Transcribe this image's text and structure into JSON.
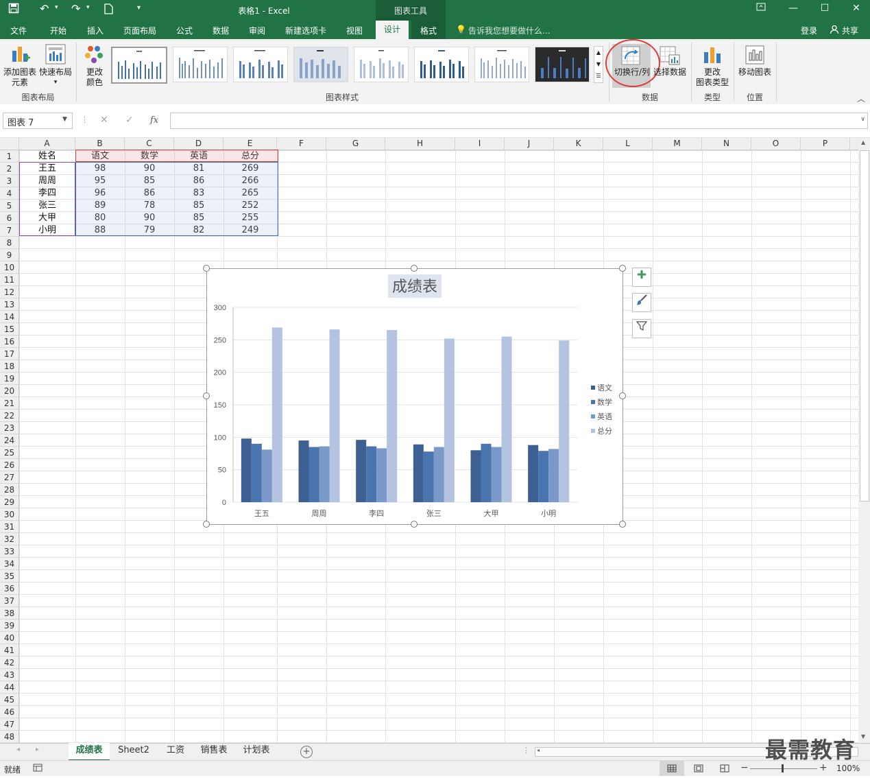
{
  "title_bar": {
    "doc_title": "表格1 - Excel",
    "tools_label": "图表工具"
  },
  "menu": {
    "tabs": [
      "文件",
      "开始",
      "插入",
      "页面布局",
      "公式",
      "数据",
      "审阅",
      "新建选项卡",
      "视图"
    ],
    "design": "设计",
    "format": "格式",
    "tell_me": "告诉我您想要做什么...",
    "login": "登录",
    "share": "共享"
  },
  "ribbon": {
    "add_element_1": "添加图表",
    "add_element_2": "元素",
    "quick_layout": "快速布局",
    "change_color_1": "更改",
    "change_color_2": "颜色",
    "group_layout": "图表布局",
    "group_styles": "图表样式",
    "switch_row_col": "切换行/列",
    "select_data": "选择数据",
    "group_data": "数据",
    "change_type_1": "更改",
    "change_type_2": "图表类型",
    "group_type": "类型",
    "move_chart": "移动图表",
    "group_location": "位置"
  },
  "formula_bar": {
    "name_box": "图表 7",
    "fx": "fx"
  },
  "columns": [
    "A",
    "B",
    "C",
    "D",
    "E",
    "F",
    "G",
    "H",
    "I",
    "J",
    "K",
    "L",
    "M",
    "N",
    "O",
    "P"
  ],
  "table": {
    "headers": [
      "姓名",
      "语文",
      "数学",
      "英语",
      "总分"
    ],
    "rows": [
      [
        "王五",
        "98",
        "90",
        "81",
        "269"
      ],
      [
        "周周",
        "95",
        "85",
        "86",
        "266"
      ],
      [
        "李四",
        "96",
        "86",
        "83",
        "265"
      ],
      [
        "张三",
        "89",
        "78",
        "85",
        "252"
      ],
      [
        "大甲",
        "80",
        "90",
        "85",
        "255"
      ],
      [
        "小明",
        "88",
        "79",
        "82",
        "249"
      ]
    ]
  },
  "chart_data": {
    "type": "bar",
    "title": "成绩表",
    "categories": [
      "王五",
      "周周",
      "李四",
      "张三",
      "大甲",
      "小明"
    ],
    "series": [
      {
        "name": "语文",
        "values": [
          98,
          95,
          96,
          89,
          80,
          88
        ],
        "color": "#3d5f91"
      },
      {
        "name": "数学",
        "values": [
          90,
          85,
          86,
          78,
          90,
          79
        ],
        "color": "#4a74ad"
      },
      {
        "name": "英语",
        "values": [
          81,
          86,
          83,
          85,
          85,
          82
        ],
        "color": "#7a98c8"
      },
      {
        "name": "总分",
        "values": [
          269,
          266,
          265,
          252,
          255,
          249
        ],
        "color": "#b4c3e0"
      }
    ],
    "ylim": [
      0,
      300
    ],
    "yticks": [
      "0",
      "50",
      "100",
      "150",
      "200",
      "250",
      "300"
    ],
    "grid": true,
    "legend": "right"
  },
  "sheets": [
    "成绩表",
    "Sheet2",
    "工资",
    "销售表",
    "计划表"
  ],
  "status": {
    "ready": "就绪",
    "zoom": "100%"
  },
  "watermark": "最需教育"
}
